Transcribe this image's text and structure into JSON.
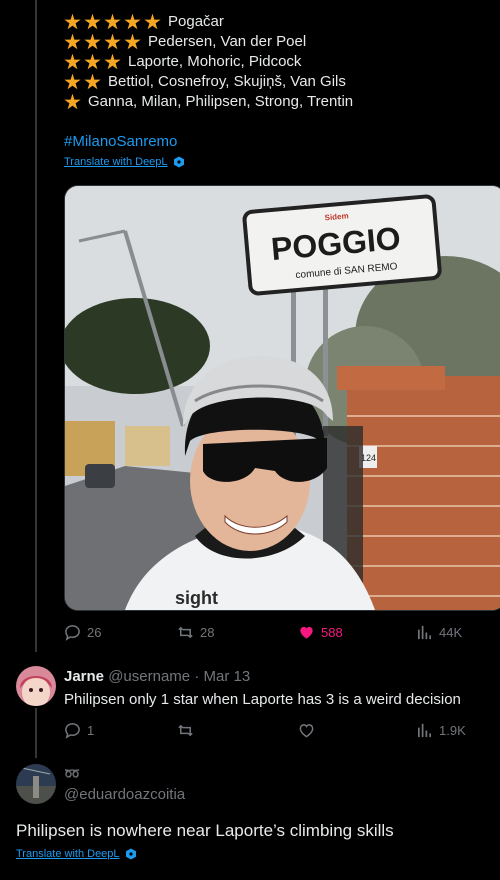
{
  "ratings": [
    {
      "stars": 5,
      "names": "Pogačar"
    },
    {
      "stars": 4,
      "names": "Pedersen, Van der Poel"
    },
    {
      "stars": 3,
      "names": "Laporte, Mohoric, Pidcock"
    },
    {
      "stars": 2,
      "names": "Bettiol, Cosnefroy, Skujiņš, Van Gils"
    },
    {
      "stars": 1,
      "names": "Ganna, Milan, Philipsen, Strong, Trentin"
    }
  ],
  "tweet": {
    "hashtag": "#MilanoSanremo",
    "translate_label": "Translate with DeepL",
    "photo": {
      "sign_title": "POGGIO",
      "sign_sub": "comune di SAN REMO",
      "sign_brand": "Sidem",
      "house_number": "124",
      "jersey_text": "sight"
    },
    "stats": {
      "replies": "26",
      "retweets": "28",
      "likes": "588",
      "views": "44K"
    }
  },
  "reply1": {
    "name": "Jarne",
    "handle": "@username",
    "sep": "·",
    "date": "Mar 13",
    "text": "Philipsen only 1 star when Laporte has 3 is a weird decision",
    "stats": {
      "replies": "1",
      "views": "1.9K"
    }
  },
  "reply2": {
    "badge": "➿",
    "handle": "@eduardoazcoitia",
    "text": "Philipsen is nowhere near Laporte’s climbing skills",
    "translate_label": "Translate with DeepL"
  },
  "colors": {
    "accent": "#1d9bf0",
    "like": "#f91880",
    "star": "#f5a623",
    "muted": "#71767b"
  }
}
